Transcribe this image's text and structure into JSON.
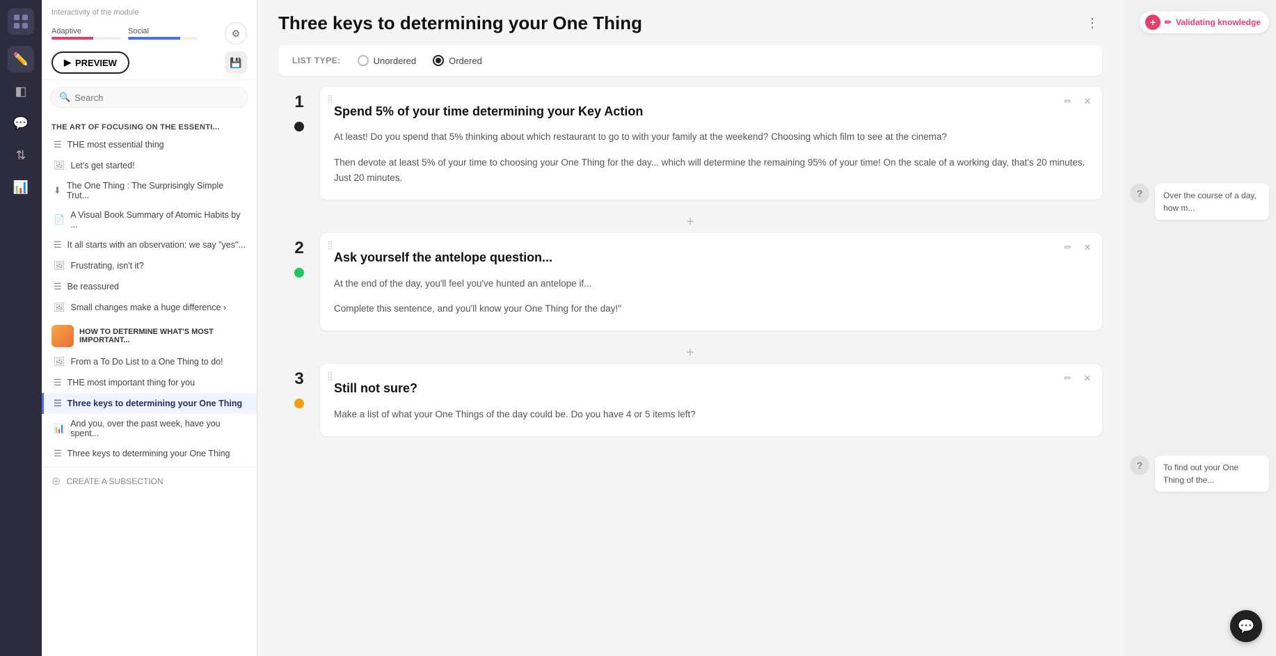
{
  "iconBar": {
    "logo": "⊞"
  },
  "sidebar": {
    "interactivityLabel": "Interactivity of the module",
    "adaptiveLabel": "Adaptive",
    "socialLabel": "Social",
    "previewLabel": "PREVIEW",
    "searchPlaceholder": "Search",
    "section1Header": "THE ART OF FOCUSING ON THE ESSENTI...",
    "section1Items": [
      {
        "id": "item1",
        "icon": "list",
        "label": "THE most essential thing"
      },
      {
        "id": "item2",
        "icon": "image",
        "label": "Let's get started!"
      },
      {
        "id": "item3",
        "icon": "download",
        "label": "The One Thing : The Surprisingly Simple Trut..."
      },
      {
        "id": "item4",
        "icon": "doc",
        "label": "A Visual Book Summary of Atomic Habits by ..."
      },
      {
        "id": "item5",
        "icon": "list",
        "label": "It all starts with an observation: we say \"yes\"..."
      },
      {
        "id": "item6",
        "icon": "image",
        "label": "Frustrating, isn't it?"
      },
      {
        "id": "item7",
        "icon": "list",
        "label": "Be reassured"
      },
      {
        "id": "item8",
        "icon": "image",
        "label": "Small changes make a huge difference ›"
      }
    ],
    "section2Header": "HOW TO DETERMINE WHAT'S MOST IMPORTANT...",
    "section2Items": [
      {
        "id": "item9",
        "icon": "image",
        "label": "From a To Do List to a One Thing to do!"
      },
      {
        "id": "item10",
        "icon": "list",
        "label": "THE most important thing for you"
      },
      {
        "id": "item11",
        "icon": "list",
        "label": "Three keys to determining your One Thing",
        "active": true
      },
      {
        "id": "item12",
        "icon": "chart",
        "label": "And you, over the past week, have you spent..."
      },
      {
        "id": "item13",
        "icon": "list",
        "label": "Three keys to determining your One Thing"
      }
    ],
    "createSubsection": "CREATE A SUBSECTION"
  },
  "main": {
    "title": "Three keys to determining your One Thing",
    "listTypeLabel": "LIST TYPE:",
    "unorderedLabel": "Unordered",
    "orderedLabel": "Ordered",
    "cards": [
      {
        "number": "1",
        "dotColor": "black",
        "title": "Spend 5% of your time determining your Key Action",
        "paragraphs": [
          "At least! Do you spend that 5% thinking about which restaurant to go to with your family at the weekend? Choosing which film to see at the cinema?",
          "Then devote at least 5% of your time to choosing your One Thing for the day... which will determine the remaining 95% of your time! On the scale of a working day, that's 20 minutes. Just 20 minutes."
        ]
      },
      {
        "number": "2",
        "dotColor": "green",
        "title": "Ask yourself the antelope question...",
        "paragraphs": [
          "At the end of the day, you'll feel you've hunted an antelope if...",
          "Complete this sentence, and you'll know your One Thing for the day!\""
        ]
      },
      {
        "number": "3",
        "dotColor": "yellow",
        "title": "Still not sure?",
        "paragraphs": [
          "Make a list of what your One Things of the day could be. Do you have 4 or 5 items left?"
        ]
      }
    ]
  },
  "rightPanel": {
    "validatingLabel": "Validating knowledge",
    "questions": [
      {
        "text": "Over the course of a day, how m..."
      },
      {
        "text": "To find out your One Thing of the..."
      }
    ]
  },
  "chatBubble": "💬"
}
